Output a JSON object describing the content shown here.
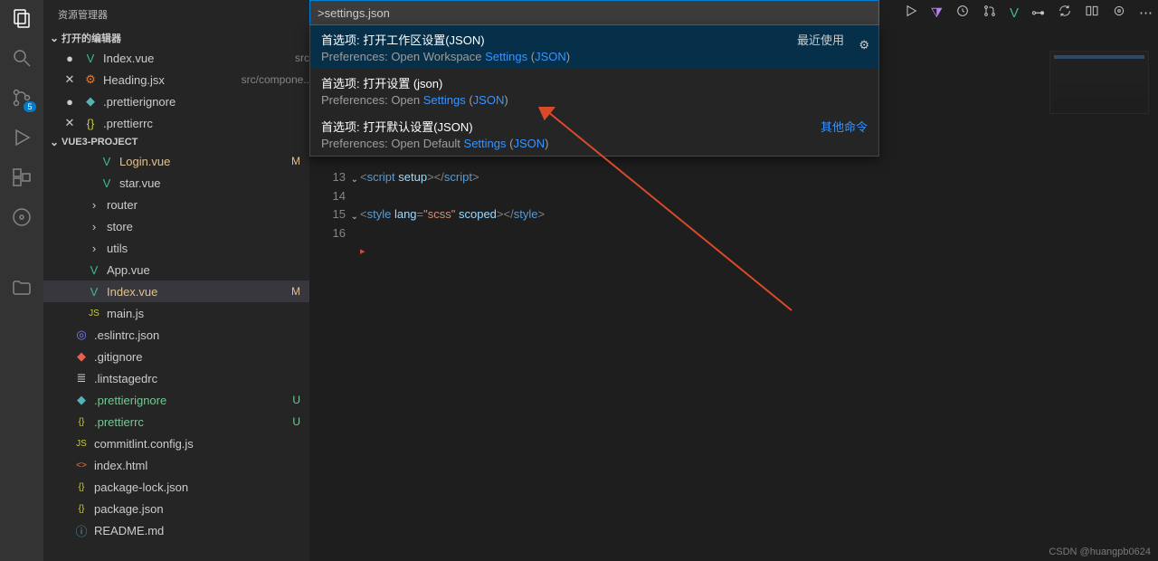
{
  "sidebar_title": "资源管理器",
  "sections": {
    "open_editors": "打开的编辑器",
    "project": "VUE3-PROJECT"
  },
  "open_editors": [
    {
      "icon": "V",
      "iconClass": "ic-vue",
      "name": "Index.vue",
      "desc": "src",
      "dirty": true
    },
    {
      "icon": "⚙",
      "iconClass": "ic-jsx",
      "name": "Heading.jsx",
      "desc": "src/compone..",
      "dirty": false
    },
    {
      "icon": "◆",
      "iconClass": "ic-prettier",
      "name": ".prettierignore",
      "desc": "",
      "dirty": true
    },
    {
      "icon": "{}",
      "iconClass": "ic-json",
      "name": ".prettierrc",
      "desc": "",
      "dirty": false
    }
  ],
  "project_tree": [
    {
      "depth": 1,
      "icon": "V",
      "iconClass": "ic-vue",
      "name": "Login.vue",
      "status": "M",
      "git": "git-M"
    },
    {
      "depth": 1,
      "icon": "V",
      "iconClass": "ic-vue",
      "name": "star.vue"
    },
    {
      "depth": 0,
      "icon": "›",
      "iconClass": "ic-folder",
      "name": "router"
    },
    {
      "depth": 0,
      "icon": "›",
      "iconClass": "ic-folder",
      "name": "store"
    },
    {
      "depth": 0,
      "icon": "›",
      "iconClass": "ic-folder",
      "name": "utils"
    },
    {
      "depth": 0,
      "icon": "V",
      "iconClass": "ic-vue",
      "name": "App.vue"
    },
    {
      "depth": 0,
      "icon": "V",
      "iconClass": "ic-vue",
      "name": "Index.vue",
      "status": "M",
      "git": "git-M",
      "selected": true
    },
    {
      "depth": 0,
      "icon": "JS",
      "iconClass": "ic-js",
      "name": "main.js"
    },
    {
      "depth": -1,
      "icon": "◎",
      "iconClass": "ic-eslint",
      "name": ".eslintrc.json"
    },
    {
      "depth": -1,
      "icon": "◆",
      "iconClass": "ic-git",
      "name": ".gitignore"
    },
    {
      "depth": -1,
      "icon": "≣",
      "iconClass": "ic-lint",
      "name": ".lintstagedrc"
    },
    {
      "depth": -1,
      "icon": "◆",
      "iconClass": "ic-prettier",
      "name": ".prettierignore",
      "status": "U",
      "git": "git-U"
    },
    {
      "depth": -1,
      "icon": "{}",
      "iconClass": "ic-json",
      "name": ".prettierrc",
      "status": "U",
      "git": "git-U"
    },
    {
      "depth": -1,
      "icon": "JS",
      "iconClass": "ic-js",
      "name": "commitlint.config.js"
    },
    {
      "depth": -1,
      "icon": "<>",
      "iconClass": "ic-html",
      "name": "index.html"
    },
    {
      "depth": -1,
      "icon": "{}",
      "iconClass": "ic-json",
      "name": "package-lock.json"
    },
    {
      "depth": -1,
      "icon": "{}",
      "iconClass": "ic-json",
      "name": "package.json"
    },
    {
      "depth": -1,
      "icon": "ⓘ",
      "iconClass": "ic-readme",
      "name": "README.md"
    }
  ],
  "scm_badge": "5",
  "quickinput": ">settings.json",
  "dropdown": [
    {
      "selected": true,
      "title": "首选项: 打开工作区设置(JSON)",
      "sub_prefix": "Preferences: Open Workspace ",
      "sub_hl1": "Settings",
      "sub_mid": " (",
      "sub_hl2": "JSON",
      "sub_suffix": ")",
      "badge": "最近使用",
      "gear": true
    },
    {
      "title": "首选项: 打开设置 (json)",
      "sub_prefix": "Preferences: Open ",
      "sub_hl1": "Settings",
      "sub_mid": " (",
      "sub_hl2": "JSON",
      "sub_suffix": ")"
    },
    {
      "title": "首选项: 打开默认设置(JSON)",
      "sub_prefix": "Preferences: Open Default ",
      "sub_hl1": "Settings",
      "sub_mid": " (",
      "sub_hl2": "JSON",
      "sub_suffix": ")",
      "other": "其他命令"
    }
  ],
  "code": {
    "l13": {
      "n": "13",
      "a": "<",
      "b": "script",
      "c": " ",
      "d": "setup",
      "e": "></",
      "f": "script",
      "g": ">"
    },
    "l14": {
      "n": "14"
    },
    "l15": {
      "n": "15",
      "a": "<",
      "b": "style",
      "c": " ",
      "d": "lang",
      "e": "=",
      "f": "\"scss\"",
      "g": " ",
      "h": "scoped",
      "i": "></",
      "j": "style",
      "k": ">"
    },
    "l16": {
      "n": "16"
    }
  },
  "watermark": "CSDN @huangpb0624"
}
